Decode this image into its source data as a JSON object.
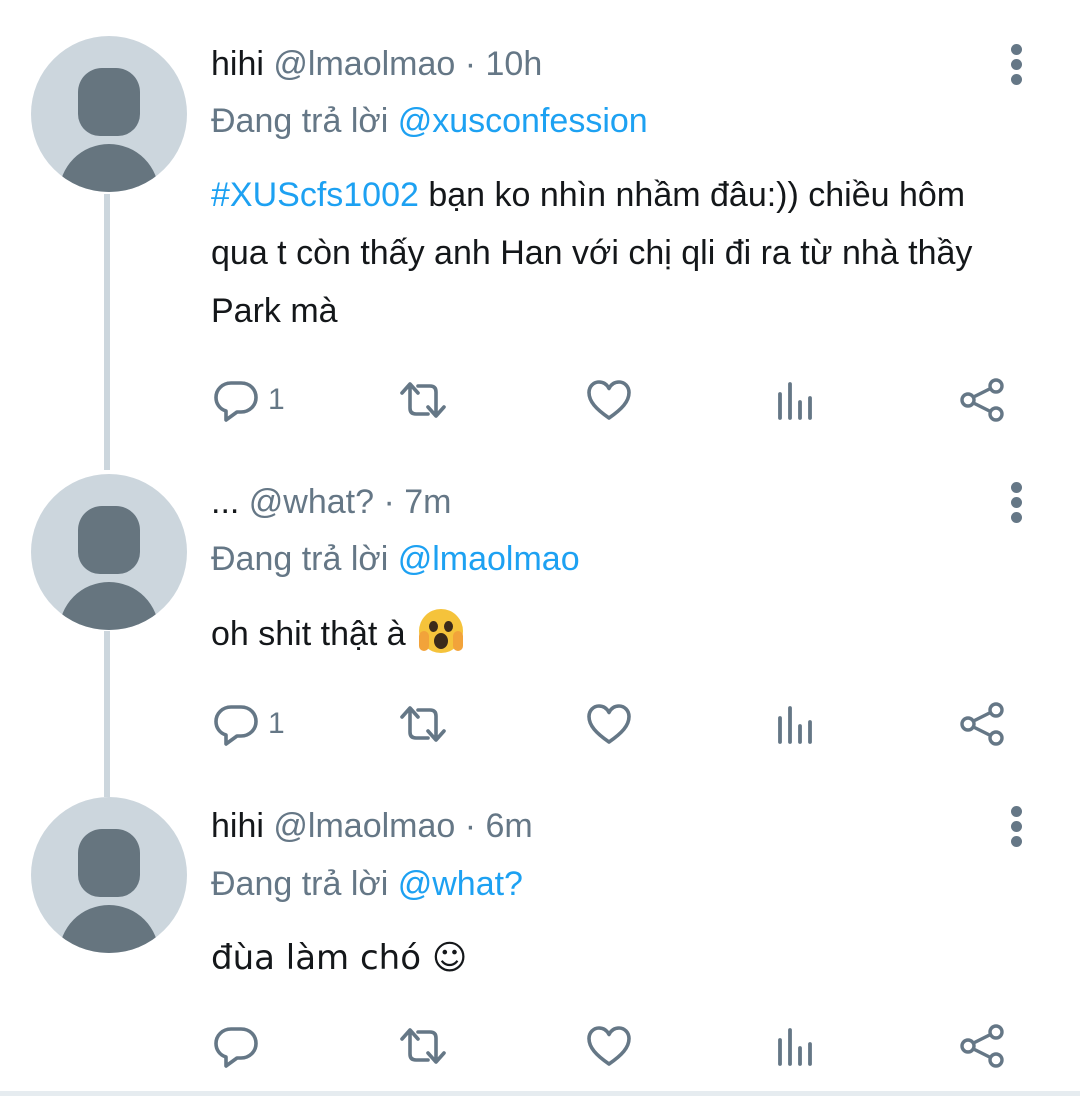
{
  "colors": {
    "link": "#1da1f2",
    "muted": "#657786",
    "text": "#14171a",
    "avatar_bg": "#ccd6dd"
  },
  "tweets": [
    {
      "name": "hihi",
      "handle": "@lmaolmao",
      "time": "· 10h",
      "replying_label": "Đang trả lời",
      "replying_to": "@xusconfession",
      "hashtag": "#XUScfs1002",
      "text": " bạn ko nhìn nhầm đâu:)) chiều hôm qua t còn thấy anh Han với chị qli đi ra từ nhà thầy Park mà",
      "reply_count": "1",
      "icons": [
        "reply-icon",
        "retweet-icon",
        "like-icon",
        "analytics-icon",
        "share-icon",
        "more-options-icon"
      ]
    },
    {
      "name": "...",
      "handle": "@what?",
      "time": "· 7m",
      "replying_label": "Đang trả lời",
      "replying_to": "@lmaolmao",
      "text": "oh shit thật à ",
      "emoji": "screaming-in-fear-emoji",
      "reply_count": "1"
    },
    {
      "name": "hihi",
      "handle": "@lmaolmao",
      "time": "· 6m",
      "replying_label": "Đang trả lời",
      "replying_to": "@what?",
      "text": "đùa làm chó ☺",
      "reply_count": ""
    }
  ]
}
